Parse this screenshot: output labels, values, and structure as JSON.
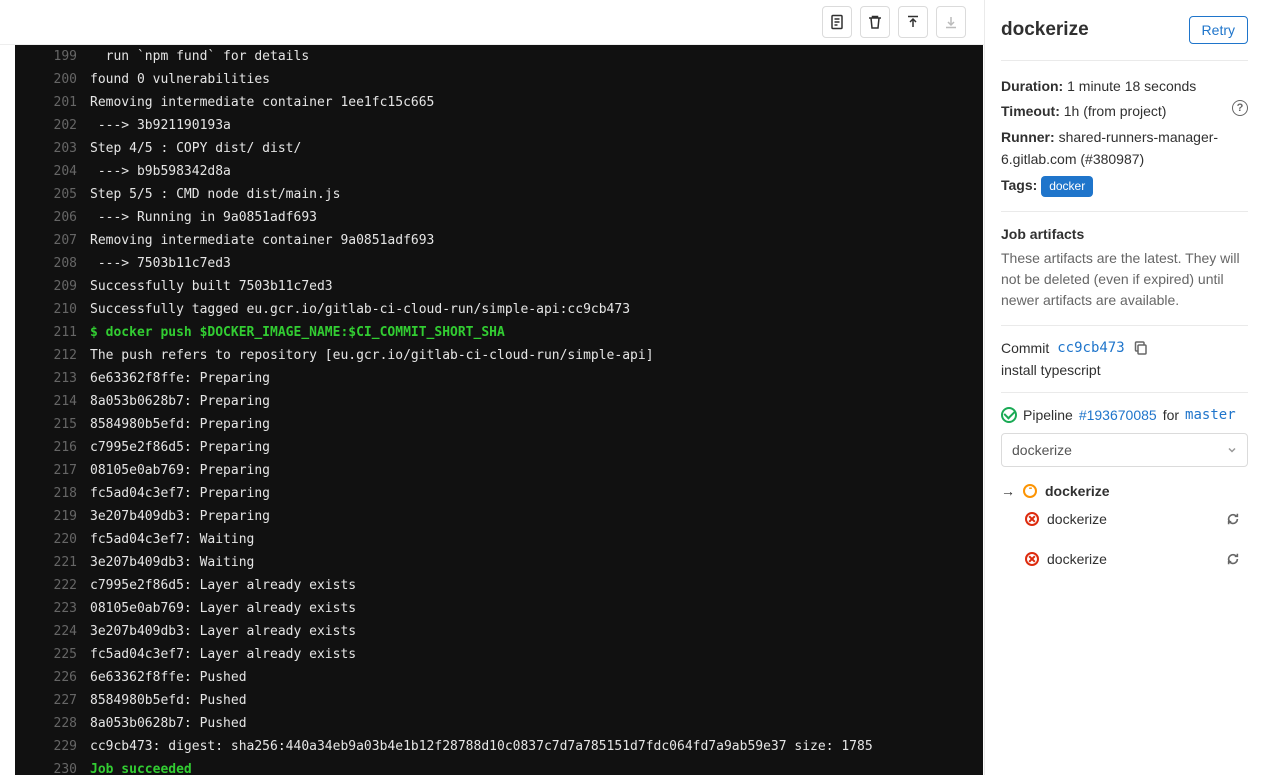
{
  "sidebar": {
    "title": "dockerize",
    "retry_label": "Retry",
    "duration_label": "Duration:",
    "duration_value": "1 minute 18 seconds",
    "timeout_label": "Timeout:",
    "timeout_value": "1h (from project)",
    "runner_label": "Runner:",
    "runner_value": "shared-runners-manager-6.gitlab.com (#380987)",
    "tags_label": "Tags:",
    "tag_value": "docker",
    "artifacts_heading": "Job artifacts",
    "artifacts_desc": "These artifacts are the latest. They will not be deleted (even if expired) until newer artifacts are available.",
    "commit_label": "Commit",
    "commit_sha": "cc9cb473",
    "commit_msg": "install typescript",
    "pipeline_word": "Pipeline",
    "pipeline_id": "#193670085",
    "pipeline_for": "for",
    "pipeline_branch": "master",
    "stage_select": "dockerize",
    "stage_name": "dockerize",
    "jobs": [
      {
        "name": "dockerize"
      },
      {
        "name": "dockerize"
      }
    ]
  },
  "log": [
    {
      "n": 199,
      "t": "  run `npm fund` for details",
      "c": ""
    },
    {
      "n": 200,
      "t": "found 0 vulnerabilities",
      "c": ""
    },
    {
      "n": 201,
      "t": "Removing intermediate container 1ee1fc15c665",
      "c": ""
    },
    {
      "n": 202,
      "t": " ---> 3b921190193a",
      "c": ""
    },
    {
      "n": 203,
      "t": "Step 4/5 : COPY dist/ dist/",
      "c": ""
    },
    {
      "n": 204,
      "t": " ---> b9b598342d8a",
      "c": ""
    },
    {
      "n": 205,
      "t": "Step 5/5 : CMD node dist/main.js",
      "c": ""
    },
    {
      "n": 206,
      "t": " ---> Running in 9a0851adf693",
      "c": ""
    },
    {
      "n": 207,
      "t": "Removing intermediate container 9a0851adf693",
      "c": ""
    },
    {
      "n": 208,
      "t": " ---> 7503b11c7ed3",
      "c": ""
    },
    {
      "n": 209,
      "t": "Successfully built 7503b11c7ed3",
      "c": ""
    },
    {
      "n": 210,
      "t": "Successfully tagged eu.gcr.io/gitlab-ci-cloud-run/simple-api:cc9cb473",
      "c": ""
    },
    {
      "n": 211,
      "t": "$ docker push $DOCKER_IMAGE_NAME:$CI_COMMIT_SHORT_SHA",
      "c": "green"
    },
    {
      "n": 212,
      "t": "The push refers to repository [eu.gcr.io/gitlab-ci-cloud-run/simple-api]",
      "c": ""
    },
    {
      "n": 213,
      "t": "6e63362f8ffe: Preparing",
      "c": ""
    },
    {
      "n": 214,
      "t": "8a053b0628b7: Preparing",
      "c": ""
    },
    {
      "n": 215,
      "t": "8584980b5efd: Preparing",
      "c": ""
    },
    {
      "n": 216,
      "t": "c7995e2f86d5: Preparing",
      "c": ""
    },
    {
      "n": 217,
      "t": "08105e0ab769: Preparing",
      "c": ""
    },
    {
      "n": 218,
      "t": "fc5ad04c3ef7: Preparing",
      "c": ""
    },
    {
      "n": 219,
      "t": "3e207b409db3: Preparing",
      "c": ""
    },
    {
      "n": 220,
      "t": "fc5ad04c3ef7: Waiting",
      "c": ""
    },
    {
      "n": 221,
      "t": "3e207b409db3: Waiting",
      "c": ""
    },
    {
      "n": 222,
      "t": "c7995e2f86d5: Layer already exists",
      "c": ""
    },
    {
      "n": 223,
      "t": "08105e0ab769: Layer already exists",
      "c": ""
    },
    {
      "n": 224,
      "t": "3e207b409db3: Layer already exists",
      "c": ""
    },
    {
      "n": 225,
      "t": "fc5ad04c3ef7: Layer already exists",
      "c": ""
    },
    {
      "n": 226,
      "t": "6e63362f8ffe: Pushed",
      "c": ""
    },
    {
      "n": 227,
      "t": "8584980b5efd: Pushed",
      "c": ""
    },
    {
      "n": 228,
      "t": "8a053b0628b7: Pushed",
      "c": ""
    },
    {
      "n": 229,
      "t": "cc9cb473: digest: sha256:440a34eb9a03b4e1b12f28788d10c0837c7d7a785151d7fdc064fd7a9ab59e37 size: 1785",
      "c": ""
    },
    {
      "n": 230,
      "t": "Job succeeded",
      "c": "green2"
    }
  ]
}
